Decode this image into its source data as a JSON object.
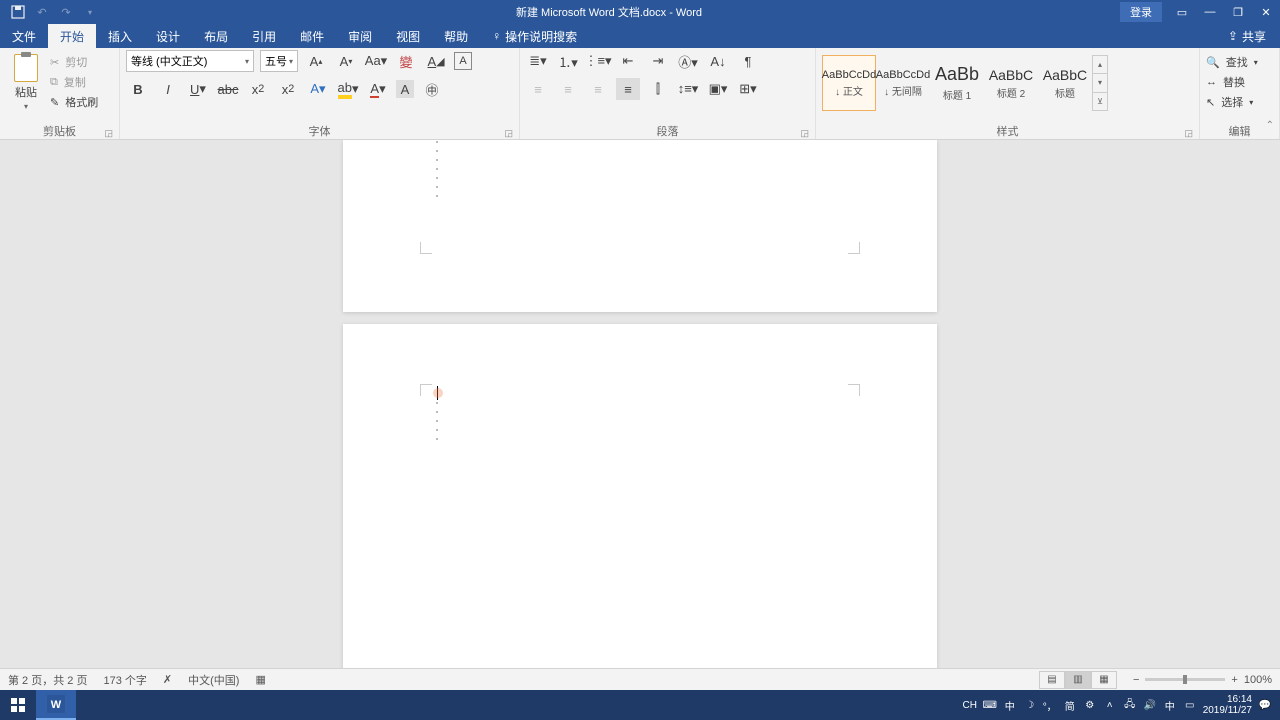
{
  "titlebar": {
    "title": "新建 Microsoft Word 文档.docx - Word",
    "login": "登录"
  },
  "tabs": {
    "file": "文件",
    "home": "开始",
    "insert": "插入",
    "design": "设计",
    "layout": "布局",
    "references": "引用",
    "mail": "邮件",
    "review": "审阅",
    "view": "视图",
    "help": "帮助",
    "tellme": "操作说明搜索",
    "share": "共享"
  },
  "ribbon": {
    "clipboard": {
      "label": "剪贴板",
      "paste": "粘贴",
      "cut": "剪切",
      "copy": "复制",
      "format_painter": "格式刷"
    },
    "font": {
      "label": "字体",
      "family": "等线 (中文正文)",
      "size": "五号"
    },
    "paragraph": {
      "label": "段落"
    },
    "styles": {
      "label": "样式",
      "items": [
        {
          "preview": "AaBbCcDd",
          "name": "↓ 正文"
        },
        {
          "preview": "AaBbCcDd",
          "name": "↓ 无间隔"
        },
        {
          "preview": "AaBb",
          "name": "标题 1"
        },
        {
          "preview": "AaBbC",
          "name": "标题 2"
        },
        {
          "preview": "AaBbC",
          "name": "标题"
        }
      ]
    },
    "editing": {
      "label": "编辑",
      "find": "查找",
      "replace": "替换",
      "select": "选择"
    }
  },
  "statusbar": {
    "page": "第 2 页，共 2 页",
    "words": "173 个字",
    "language": "中文(中国)",
    "zoom": "100%"
  },
  "tray": {
    "ime1": "CH",
    "ime2": "中",
    "ime3": "简",
    "time": "16:14",
    "date": "2019/11/27"
  }
}
